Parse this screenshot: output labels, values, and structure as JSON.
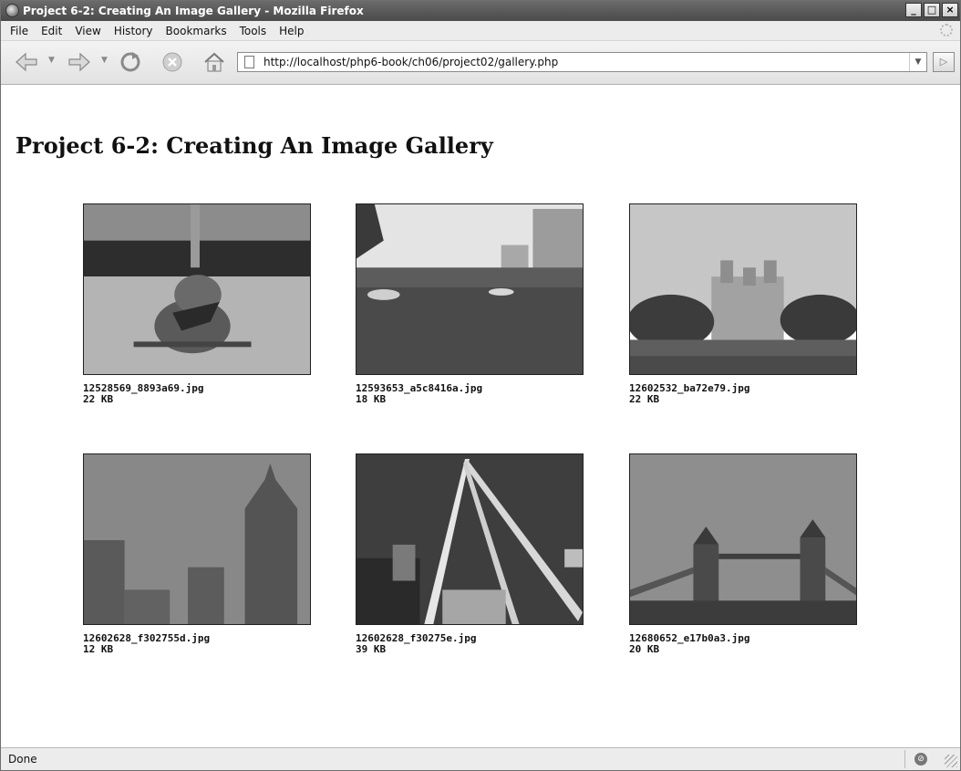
{
  "window": {
    "title": "Project 6-2: Creating An Image Gallery - Mozilla Firefox",
    "controls": {
      "minimize": "_",
      "maximize": "□",
      "close": "×"
    }
  },
  "menu": {
    "items": [
      "File",
      "Edit",
      "View",
      "History",
      "Bookmarks",
      "Tools",
      "Help"
    ]
  },
  "toolbar": {
    "icons": [
      "back-icon",
      "forward-icon",
      "reload-icon",
      "stop-icon",
      "home-icon"
    ],
    "url": "http://localhost/php6-book/ch06/project02/gallery.php"
  },
  "page": {
    "heading": "Project 6-2: Creating An Image Gallery",
    "gallery": [
      {
        "filename": "12528569_8893a69.jpg",
        "size": "22 KB"
      },
      {
        "filename": "12593653_a5c8416a.jpg",
        "size": "18 KB"
      },
      {
        "filename": "12602532_ba72e79.jpg",
        "size": "22 KB"
      },
      {
        "filename": "12602628_f302755d.jpg",
        "size": "12 KB"
      },
      {
        "filename": "12602628_f30275e.jpg",
        "size": "39 KB"
      },
      {
        "filename": "12680652_e17b0a3.jpg",
        "size": "20 KB"
      }
    ]
  },
  "status": {
    "text": "Done"
  }
}
